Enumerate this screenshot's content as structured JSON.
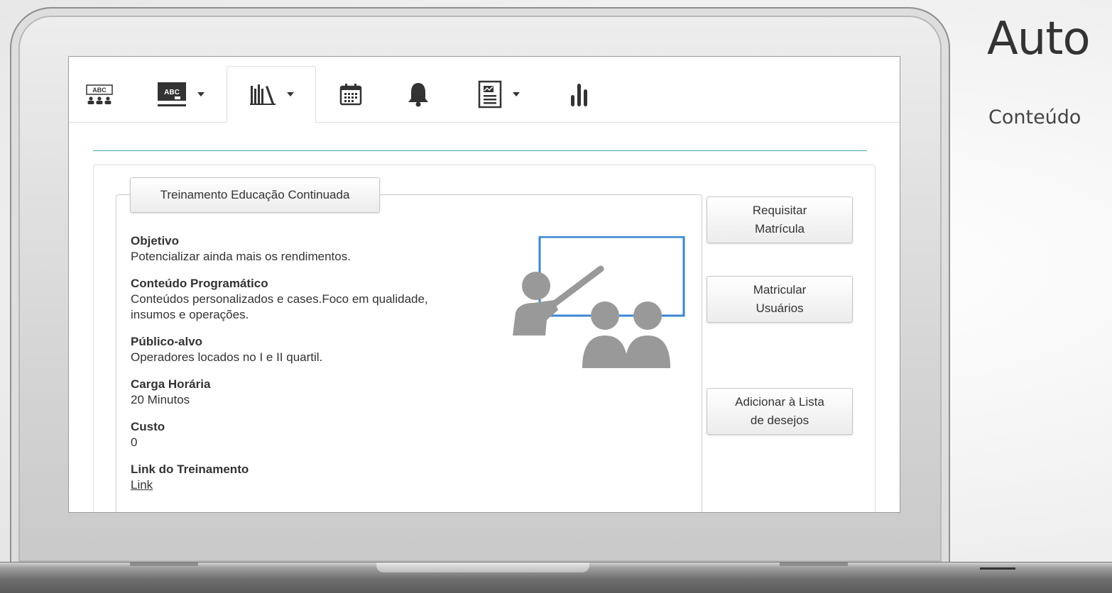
{
  "side_heading": {
    "title": "Auto",
    "subtitle": "Conteúdo"
  },
  "navbar": {
    "tabs": [
      {
        "icon": "abc-classroom-icon",
        "has_dropdown": false,
        "active": false
      },
      {
        "icon": "abc-board-icon",
        "has_dropdown": true,
        "active": false
      },
      {
        "icon": "library-books-icon",
        "has_dropdown": true,
        "active": true
      },
      {
        "icon": "calendar-icon",
        "has_dropdown": false,
        "active": false
      },
      {
        "icon": "bell-icon",
        "has_dropdown": false,
        "active": false
      },
      {
        "icon": "report-document-icon",
        "has_dropdown": true,
        "active": false
      },
      {
        "icon": "bar-chart-icon",
        "has_dropdown": false,
        "active": false
      }
    ]
  },
  "training": {
    "title": "Treinamento Educação Continuada",
    "objetivo_label": "Objetivo",
    "objetivo_value": "Potencializar ainda mais os rendimentos.",
    "conteudo_label": "Conteúdo Programático",
    "conteudo_value_1": "Conteúdos personalizados e cases.Foco em qualidade,",
    "conteudo_value_2": "insumos e operações.",
    "publico_label": "Público-alvo",
    "publico_value": "Operadores locados no I e II quartil.",
    "carga_label": "Carga Horária",
    "carga_value": "20 Minutos",
    "custo_label": "Custo",
    "custo_value": "0",
    "link_label": "Link do Treinamento",
    "link_value": "Link"
  },
  "actions": {
    "requisitar": "Requisitar\nMatrícula",
    "matricular": "Matricular\nUsuários",
    "wishlist": "Adicionar à Lista\nde desejos"
  },
  "colors": {
    "accent_teal": "#4aa8ab",
    "illustration_blue": "#3b86d4",
    "illustration_gray": "#999999"
  }
}
